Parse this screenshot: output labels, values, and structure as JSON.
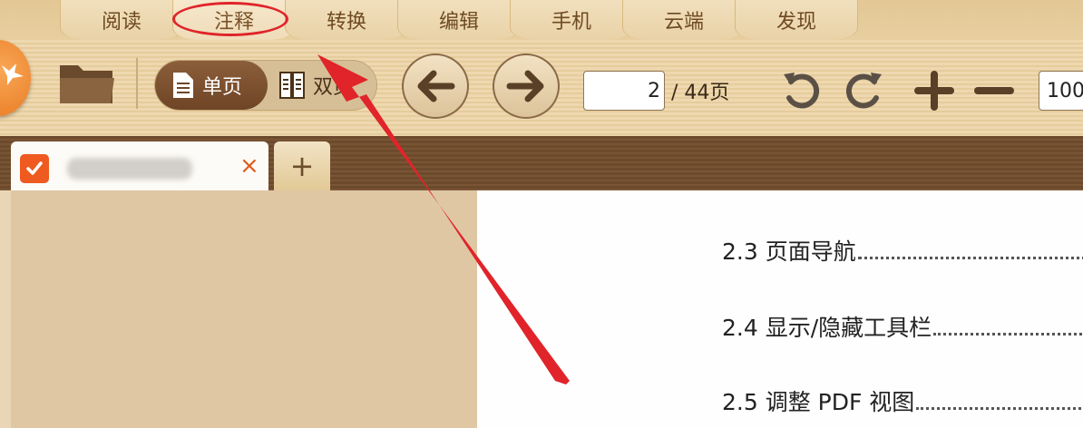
{
  "ribbon": {
    "tabs": [
      {
        "label": "阅读"
      },
      {
        "label": "注释"
      },
      {
        "label": "转换"
      },
      {
        "label": "编辑"
      },
      {
        "label": "手机"
      },
      {
        "label": "云端"
      },
      {
        "label": "发现"
      }
    ],
    "active_tab": "注释"
  },
  "toolbar": {
    "single_page_label": "单页",
    "double_page_label": "双页",
    "current_page": "2",
    "total_pages": "/ 44页",
    "zoom_value": "100"
  },
  "document": {
    "tab_name": "",
    "close_glyph": "×",
    "new_tab_glyph": "+"
  },
  "toc": {
    "entries": [
      {
        "text": "2.3 页面导航"
      },
      {
        "text": "2.4 显示/隐藏工具栏"
      },
      {
        "text": "2.5 调整 PDF 视图"
      }
    ]
  },
  "colors": {
    "accent_orange": "#ee5a1f",
    "annotation_red": "#e0242a",
    "toolbar_brown": "#6e4526"
  },
  "icons": [
    "logo-icon",
    "folder-icon",
    "single-page-icon",
    "double-page-icon",
    "arrow-left-icon",
    "arrow-right-icon",
    "rotate-left-icon",
    "rotate-right-icon",
    "zoom-in-icon",
    "zoom-out-icon",
    "close-icon",
    "plus-icon"
  ]
}
